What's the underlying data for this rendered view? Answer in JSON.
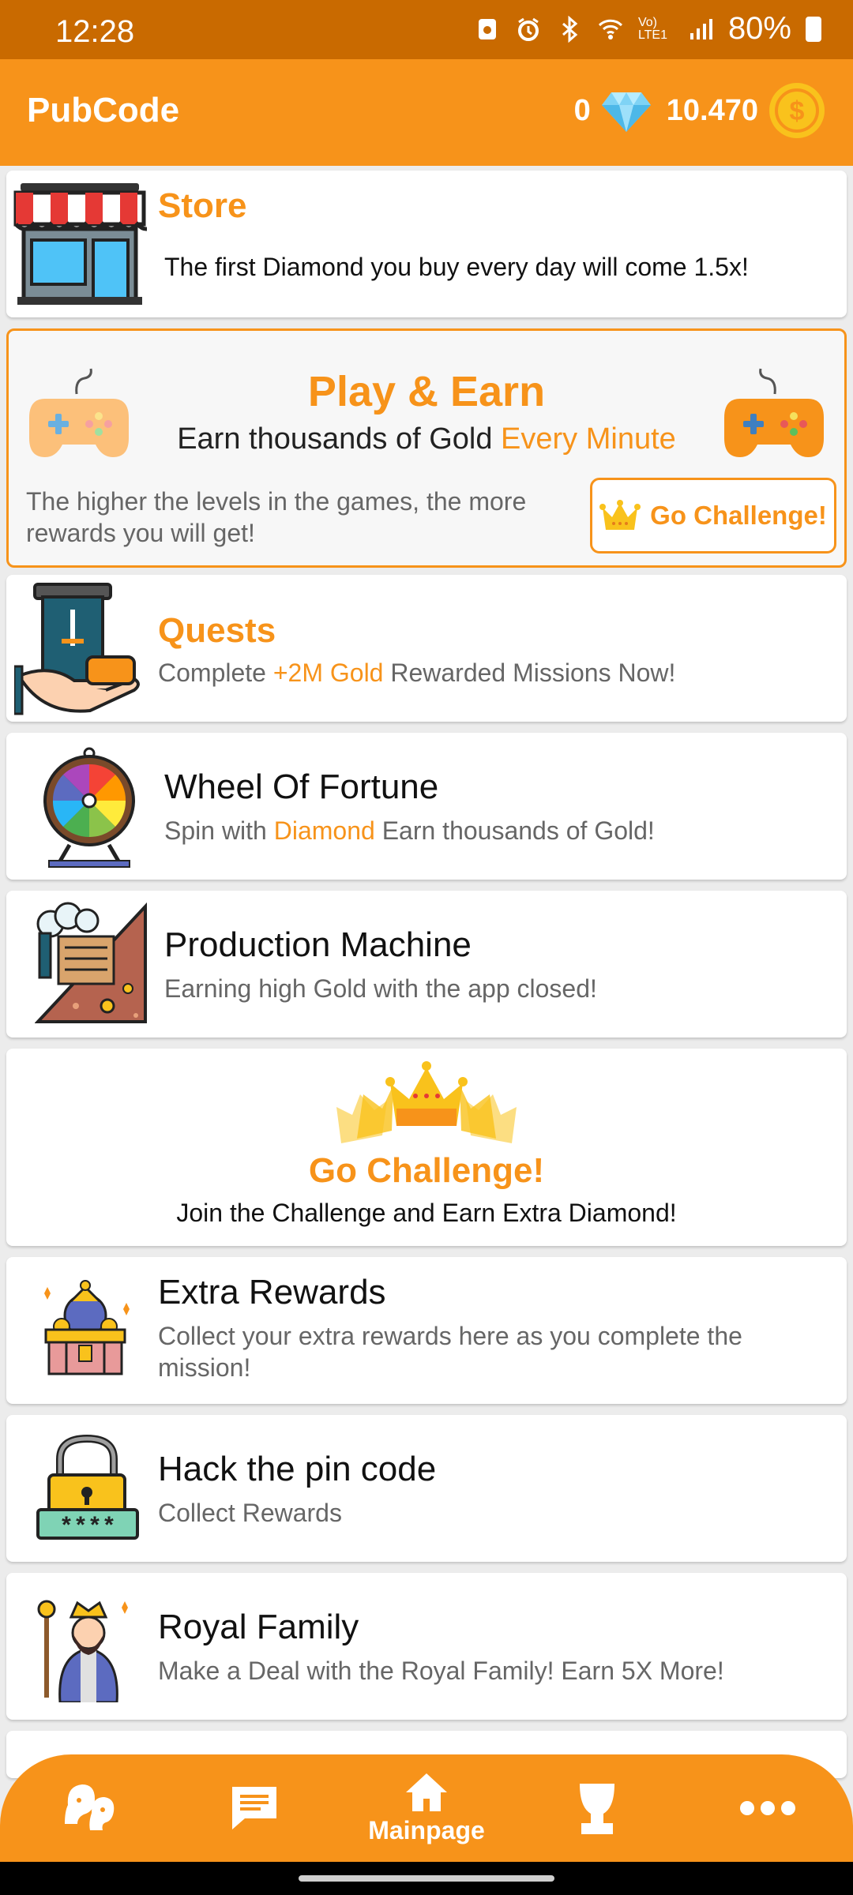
{
  "status_bar": {
    "time": "12:28",
    "battery": "80%",
    "network": "Vo) LTE1"
  },
  "app_bar": {
    "title": "PubCode",
    "diamonds": "0",
    "gold": "10.470"
  },
  "store": {
    "title": "Store",
    "subtitle": "The first Diamond you buy every day will come 1.5x!"
  },
  "play_earn": {
    "title": "Play & Earn",
    "subtitle_a": "Earn thousands of Gold ",
    "subtitle_b": "Every Minute",
    "description": "The higher the levels in the games, the more rewards you will get!",
    "button": "Go Challenge!"
  },
  "quests": {
    "title": "Quests",
    "sub_a": "Complete ",
    "sub_b": "+2M Gold",
    "sub_c": " Rewarded Missions Now!"
  },
  "wheel": {
    "title": "Wheel Of Fortune",
    "sub_a": "Spin with ",
    "sub_b": "Diamond",
    "sub_c": " Earn thousands of Gold!"
  },
  "production": {
    "title": "Production Machine",
    "subtitle": "Earning high Gold with the app closed!"
  },
  "challenge": {
    "title": "Go Challenge!",
    "subtitle": "Join the Challenge and Earn Extra Diamond!"
  },
  "extra": {
    "title": "Extra Rewards",
    "subtitle": "Collect your extra rewards here as you complete the mission!"
  },
  "pin": {
    "title": "Hack the pin code",
    "subtitle": "Collect Rewards",
    "code": "****"
  },
  "royal": {
    "title": "Royal Family",
    "subtitle": "Make a Deal with the Royal Family! Earn 5X More!"
  },
  "nav": {
    "home_label": "Mainpage"
  },
  "colors": {
    "accent": "#f7931a",
    "status_bar": "#c96a00",
    "text_secondary": "#666666"
  }
}
